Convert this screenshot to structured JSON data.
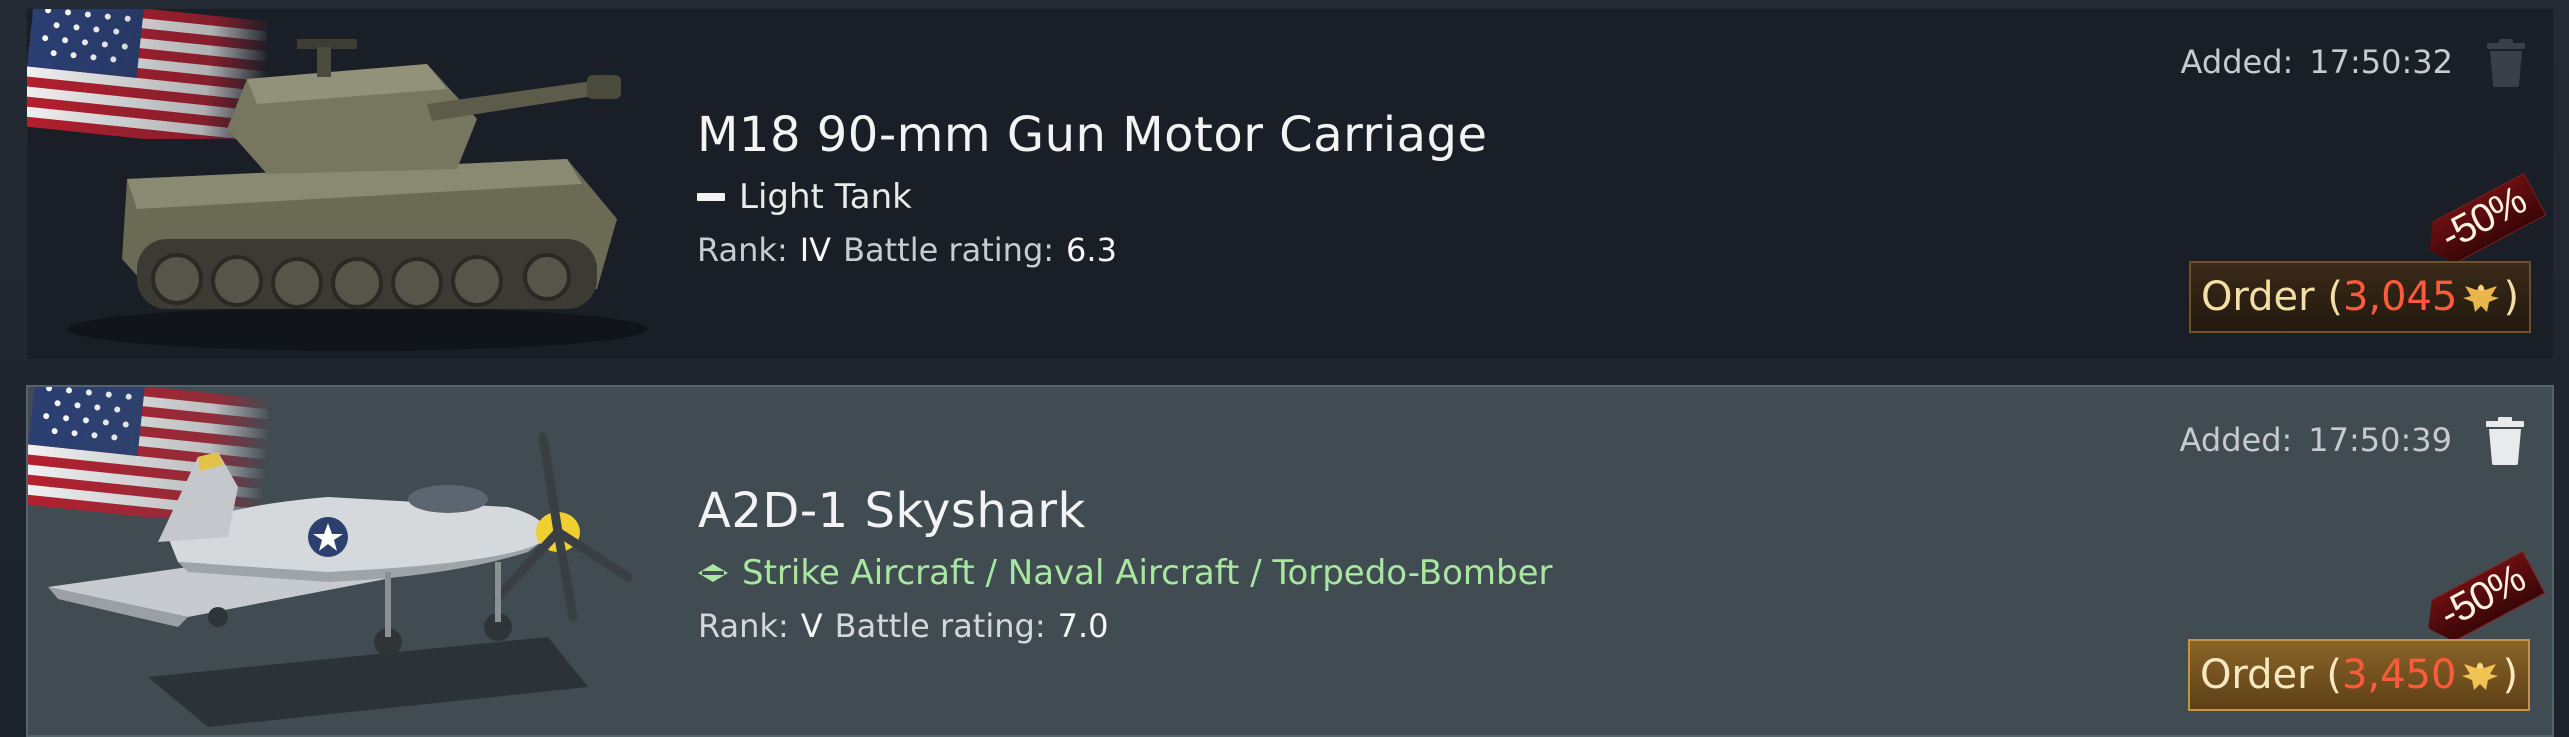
{
  "items": [
    {
      "name": "M18 90-mm Gun Motor Carriage",
      "type_label": "Light Tank",
      "rank_label": "Rank:",
      "rank_value": "IV",
      "br_label": "Battle rating:",
      "br_value": "6.3",
      "added_label": "Added:",
      "added_time": "17:50:32",
      "order_prefix": "Order (",
      "order_price": "3,045",
      "order_suffix": ")",
      "discount": "-50%",
      "flag_icon": "usa-flag-icon",
      "vehicle_icon": "tank-image",
      "type_icon": "light-tank-icon"
    },
    {
      "name": "A2D-1 Skyshark",
      "type_label": "Strike Aircraft / Naval Aircraft / Torpedo-Bomber",
      "rank_label": "Rank:",
      "rank_value": "V",
      "br_label": "Battle rating:",
      "br_value": "7.0",
      "added_label": "Added:",
      "added_time": "17:50:39",
      "order_prefix": "Order (",
      "order_price": "3,450",
      "order_suffix": ")",
      "discount": "-50%",
      "flag_icon": "usa-flag-icon",
      "vehicle_icon": "aircraft-image",
      "type_icon": "strike-aircraft-icon"
    }
  ],
  "colors": {
    "price": "#ff5a3c",
    "aircraft_type": "#a8e7a0",
    "order_gold": "#c49344"
  }
}
